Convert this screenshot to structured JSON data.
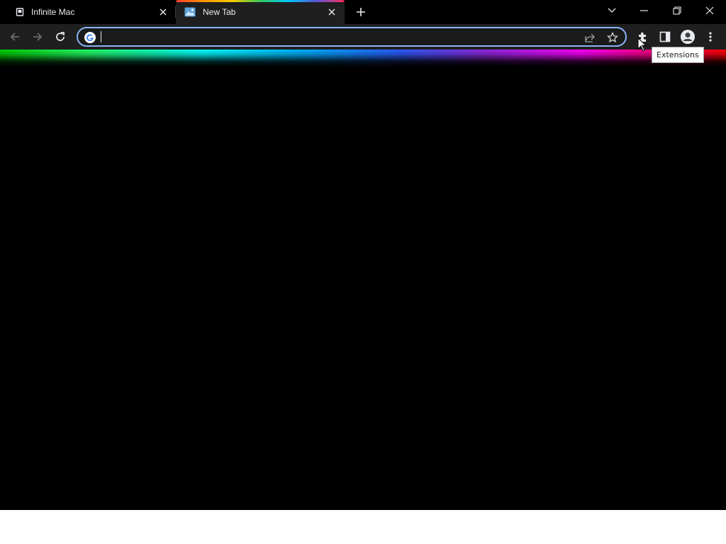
{
  "tabs": [
    {
      "title": "Infinite Mac",
      "icon": "mac-icon",
      "active": false
    },
    {
      "title": "New Tab",
      "icon": "image-icon",
      "active": true
    }
  ],
  "omnibox": {
    "value": "",
    "placeholder": ""
  },
  "tooltip": {
    "text": "Extensions"
  },
  "colors": {
    "background": "#000000",
    "toolbar": "#1f1f1f",
    "omnibox_border": "#8ab4f8",
    "text": "#e8eaed"
  },
  "toolbar_icons": [
    "back-icon",
    "forward-icon",
    "reload-icon",
    "google-icon",
    "share-icon",
    "bookmark-star-icon",
    "extensions-icon",
    "side-panel-icon",
    "profile-icon",
    "menu-icon"
  ],
  "window_controls": [
    "tab-search-icon",
    "minimize-icon",
    "restore-icon",
    "close-icon"
  ]
}
